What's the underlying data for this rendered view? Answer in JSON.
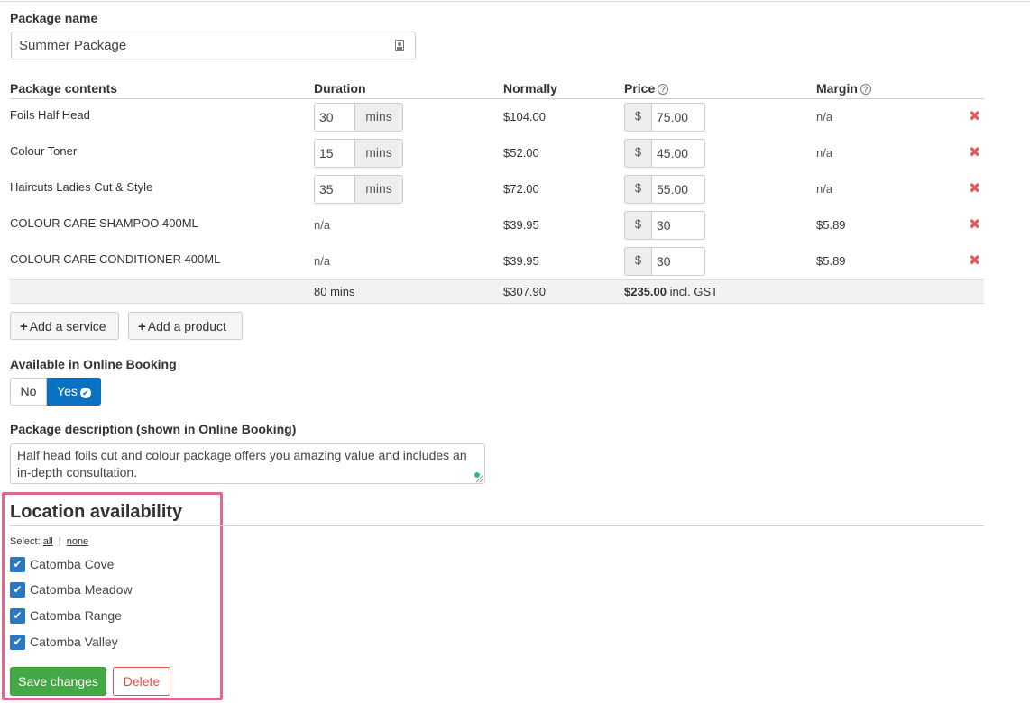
{
  "package_name": {
    "label": "Package name",
    "value": "Summer Package"
  },
  "table": {
    "headers": {
      "contents": "Package contents",
      "duration": "Duration",
      "normally": "Normally",
      "price": "Price",
      "margin": "Margin"
    },
    "help_glyph": "?",
    "currency_symbol": "$",
    "unit_label": "mins",
    "remove_glyph": "✖",
    "rows": [
      {
        "name": "Foils Half Head",
        "duration": "30",
        "normally": "$104.00",
        "price": "75.00",
        "margin": "n/a"
      },
      {
        "name": "Colour Toner",
        "duration": "15",
        "normally": "$52.00",
        "price": "45.00",
        "margin": "n/a"
      },
      {
        "name": "Haircuts Ladies Cut & Style",
        "duration": "35",
        "normally": "$72.00",
        "price": "55.00",
        "margin": "n/a"
      },
      {
        "name": "COLOUR CARE SHAMPOO 400ML",
        "duration": "n/a",
        "normally": "$39.95",
        "price": "30",
        "margin": "$5.89"
      },
      {
        "name": "COLOUR CARE CONDITIONER 400ML",
        "duration": "n/a",
        "normally": "$39.95",
        "price": "30",
        "margin": "$5.89"
      }
    ],
    "totals": {
      "duration": "80 mins",
      "normally": "$307.90",
      "price": "$235.00",
      "price_suffix": "incl. GST"
    }
  },
  "actions": {
    "add_service": "Add a service",
    "add_product": "Add a product",
    "plus_glyph": "+"
  },
  "online_booking": {
    "label": "Available in Online Booking",
    "no": "No",
    "yes": "Yes",
    "selected": "Yes"
  },
  "description": {
    "label": "Package description (shown in Online Booking)",
    "value": "Half head foils cut and colour package offers you amazing value and includes an in-depth consultation."
  },
  "locations": {
    "title": "Location availability",
    "select_prefix": "Select:",
    "select_all": "all",
    "select_sep": "|",
    "select_none": "none",
    "check_glyph": "✔",
    "items": [
      {
        "label": "Catomba Cove",
        "checked": true
      },
      {
        "label": "Catomba Meadow",
        "checked": true
      },
      {
        "label": "Catomba Range",
        "checked": true
      },
      {
        "label": "Catomba Valley",
        "checked": true
      }
    ]
  },
  "footer": {
    "save": "Save changes",
    "delete": "Delete"
  },
  "colors": {
    "primary": "#0a72c2",
    "success": "#45a846",
    "danger": "#d9534f",
    "highlight_border": "#d96a92",
    "checkbox": "#2a78c2"
  }
}
